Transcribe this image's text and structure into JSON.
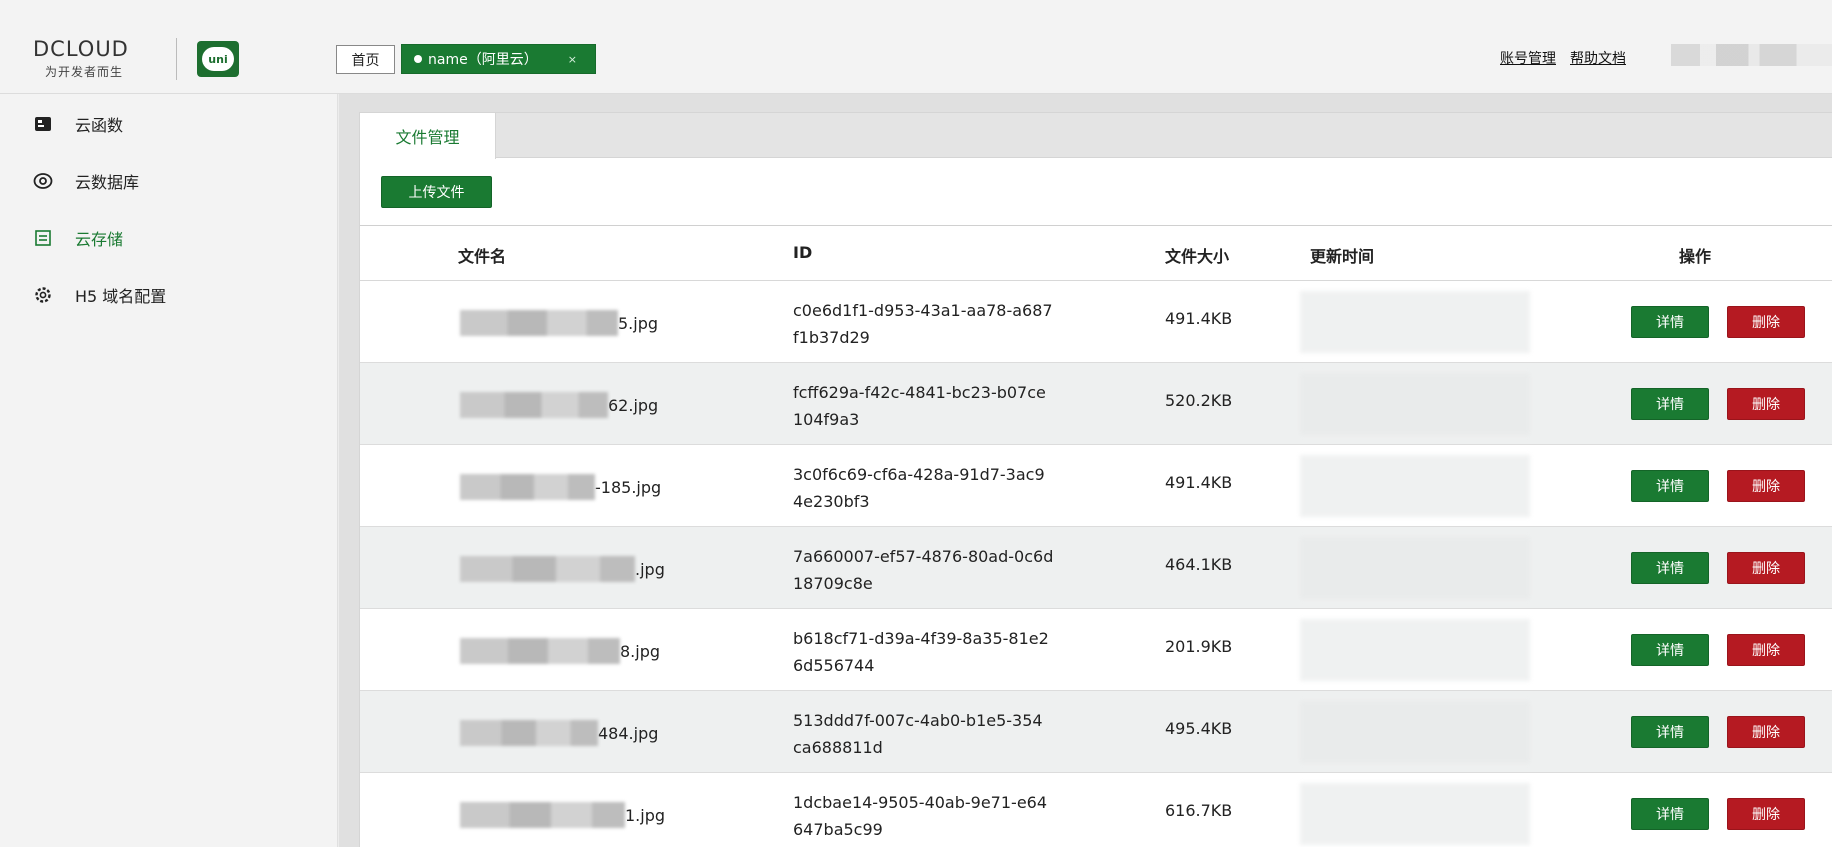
{
  "header": {
    "logo_text": "DCLOUD",
    "logo_subtitle": "为开发者而生",
    "uni_badge": "uni",
    "tabs": [
      {
        "label": "首页"
      },
      {
        "label": "name（阿里云）",
        "close": "×"
      }
    ],
    "links": [
      {
        "label": "账号管理"
      },
      {
        "label": "帮助文档"
      }
    ]
  },
  "sidebar": {
    "items": [
      {
        "label": "云函数",
        "icon": "function-icon"
      },
      {
        "label": "云数据库",
        "icon": "eye-icon"
      },
      {
        "label": "云存储",
        "icon": "storage-icon"
      },
      {
        "label": "H5 域名配置",
        "icon": "gear-icon"
      }
    ]
  },
  "main": {
    "tab_label": "文件管理",
    "upload_button": "上传文件",
    "columns": [
      "文件名",
      "ID",
      "文件大小",
      "更新时间",
      "操作"
    ],
    "rows": [
      {
        "name": "5.jpg",
        "id_line1": "c0e6d1f1-d953-43a1-aa78-a687",
        "id_line2": "f1b37d29",
        "size": "491.4KB"
      },
      {
        "name": "62.jpg",
        "id_line1": "fcff629a-f42c-4841-bc23-b07ce",
        "id_line2": "104f9a3",
        "size": "520.2KB"
      },
      {
        "name": "-185.jpg",
        "id_line1": "3c0f6c69-cf6a-428a-91d7-3ac9",
        "id_line2": "4e230bf3",
        "size": "491.4KB"
      },
      {
        "name": ".jpg",
        "id_line1": "7a660007-ef57-4876-80ad-0c6d",
        "id_line2": "18709c8e",
        "size": "464.1KB"
      },
      {
        "name": "8.jpg",
        "id_line1": "b618cf71-d39a-4f39-8a35-81e2",
        "id_line2": "6d556744",
        "size": "201.9KB"
      },
      {
        "name": "484.jpg",
        "id_line1": "513ddd7f-007c-4ab0-b1e5-354",
        "id_line2": "ca688811d",
        "size": "495.4KB"
      },
      {
        "name": "1.jpg",
        "id_line1": "1dcbae14-9505-40ab-9e71-e64",
        "id_line2": "647ba5c99",
        "size": "616.7KB"
      }
    ],
    "detail_label": "详情",
    "delete_label": "删除"
  },
  "colors": {
    "primary_green": "#1a7a32",
    "danger_red": "#b51a22"
  }
}
